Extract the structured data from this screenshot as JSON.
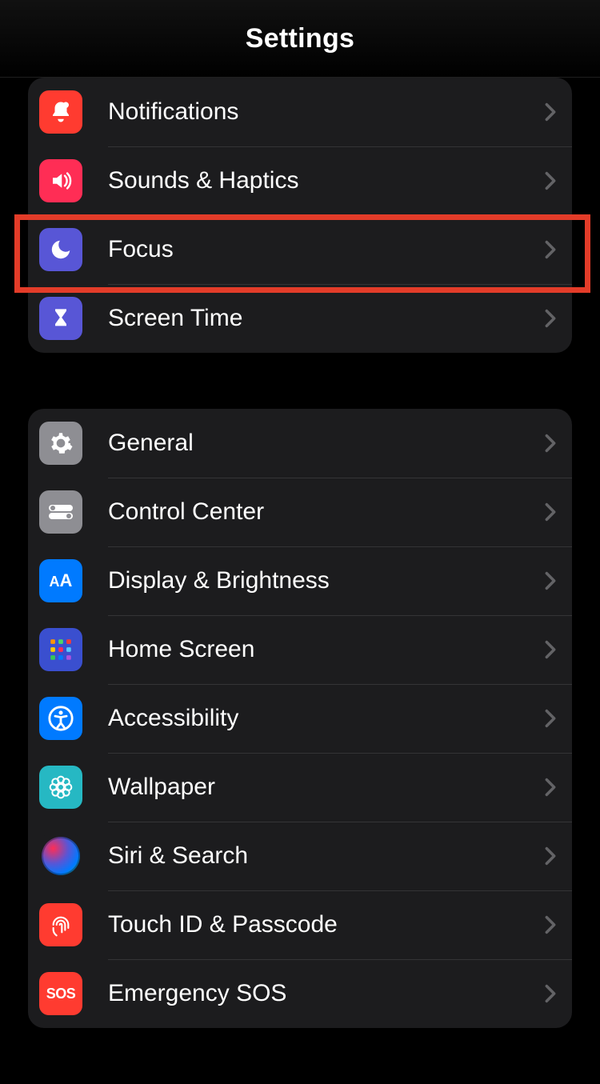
{
  "header": {
    "title": "Settings"
  },
  "group1": {
    "items": [
      {
        "label": "Notifications"
      },
      {
        "label": "Sounds & Haptics"
      },
      {
        "label": "Focus"
      },
      {
        "label": "Screen Time"
      }
    ]
  },
  "group2": {
    "items": [
      {
        "label": "General"
      },
      {
        "label": "Control Center"
      },
      {
        "label": "Display & Brightness"
      },
      {
        "label": "Home Screen"
      },
      {
        "label": "Accessibility"
      },
      {
        "label": "Wallpaper"
      },
      {
        "label": "Siri & Search"
      },
      {
        "label": "Touch ID & Passcode"
      },
      {
        "label": "Emergency SOS"
      }
    ]
  },
  "highlight": {
    "target": "focus-row"
  }
}
